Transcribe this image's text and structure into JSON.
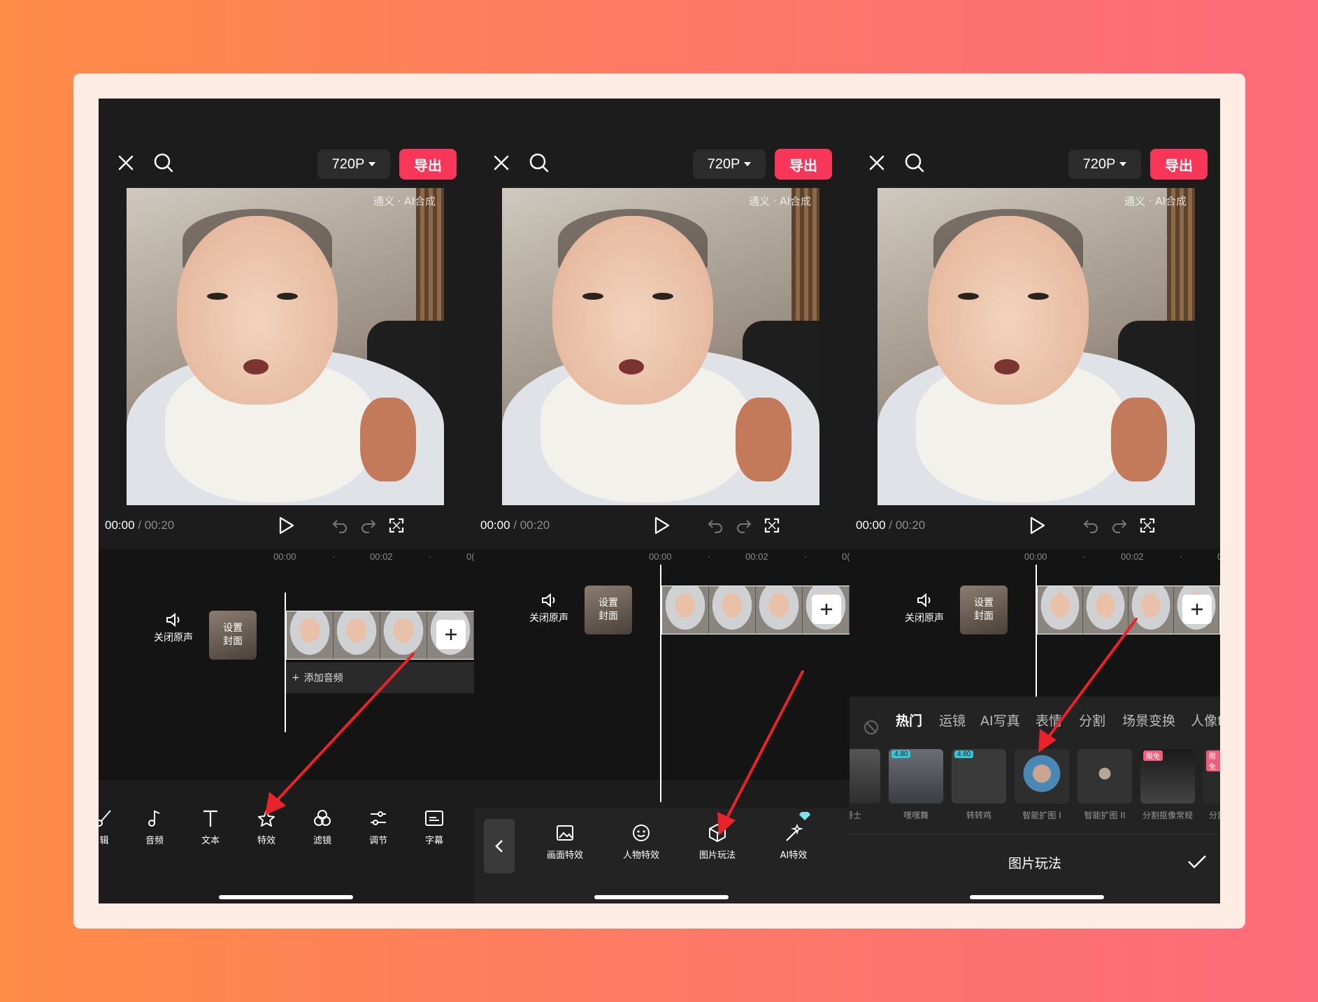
{
  "header": {
    "resolution": "720P",
    "export_label": "导出"
  },
  "preview": {
    "watermark": "通义 · AI合成"
  },
  "playback": {
    "current": "00:00",
    "separator": " / ",
    "duration": "00:20"
  },
  "timeline": {
    "ticks": [
      "00:00",
      "·",
      "00:02",
      "·",
      "0("
    ],
    "mute_label": "关闭原声",
    "cover_line1": "设置",
    "cover_line2": "封面",
    "add_audio_label": "添加音频"
  },
  "toolbar": {
    "items": [
      {
        "label": "辑",
        "icon": "scissors-icon"
      },
      {
        "label": "音频",
        "icon": "music-note-icon"
      },
      {
        "label": "文本",
        "icon": "text-icon"
      },
      {
        "label": "特效",
        "icon": "sparkle-star-icon"
      },
      {
        "label": "滤镜",
        "icon": "filter-circles-icon"
      },
      {
        "label": "调节",
        "icon": "sliders-icon"
      },
      {
        "label": "字幕",
        "icon": "subtitle-icon"
      }
    ]
  },
  "effects_bar": {
    "items": [
      {
        "label": "画面特效",
        "icon": "image-effect-icon"
      },
      {
        "label": "人物特效",
        "icon": "face-effect-icon"
      },
      {
        "label": "图片玩法",
        "icon": "cube-icon"
      },
      {
        "label": "AI特效",
        "icon": "magic-wand-icon"
      }
    ]
  },
  "effect_sheet": {
    "categories": [
      "热门",
      "运镜",
      "AI写真",
      "表情",
      "分割",
      "场景变换",
      "人像f"
    ],
    "thumbs": [
      {
        "label": "爵士",
        "badge": ""
      },
      {
        "label": "嘿嘿舞",
        "badge": "4.80"
      },
      {
        "label": "转转鸡",
        "badge": "4.80"
      },
      {
        "label": "智能扩图 I",
        "badge": ""
      },
      {
        "label": "智能扩图 II",
        "badge": ""
      },
      {
        "label": "分割抠像常规",
        "badge": "限免"
      },
      {
        "label": "分割",
        "badge": "限免"
      }
    ],
    "title": "图片玩法"
  },
  "colors": {
    "accent": "#f8365a",
    "arrow": "#e8232b",
    "badge": "#3cc3d7"
  }
}
